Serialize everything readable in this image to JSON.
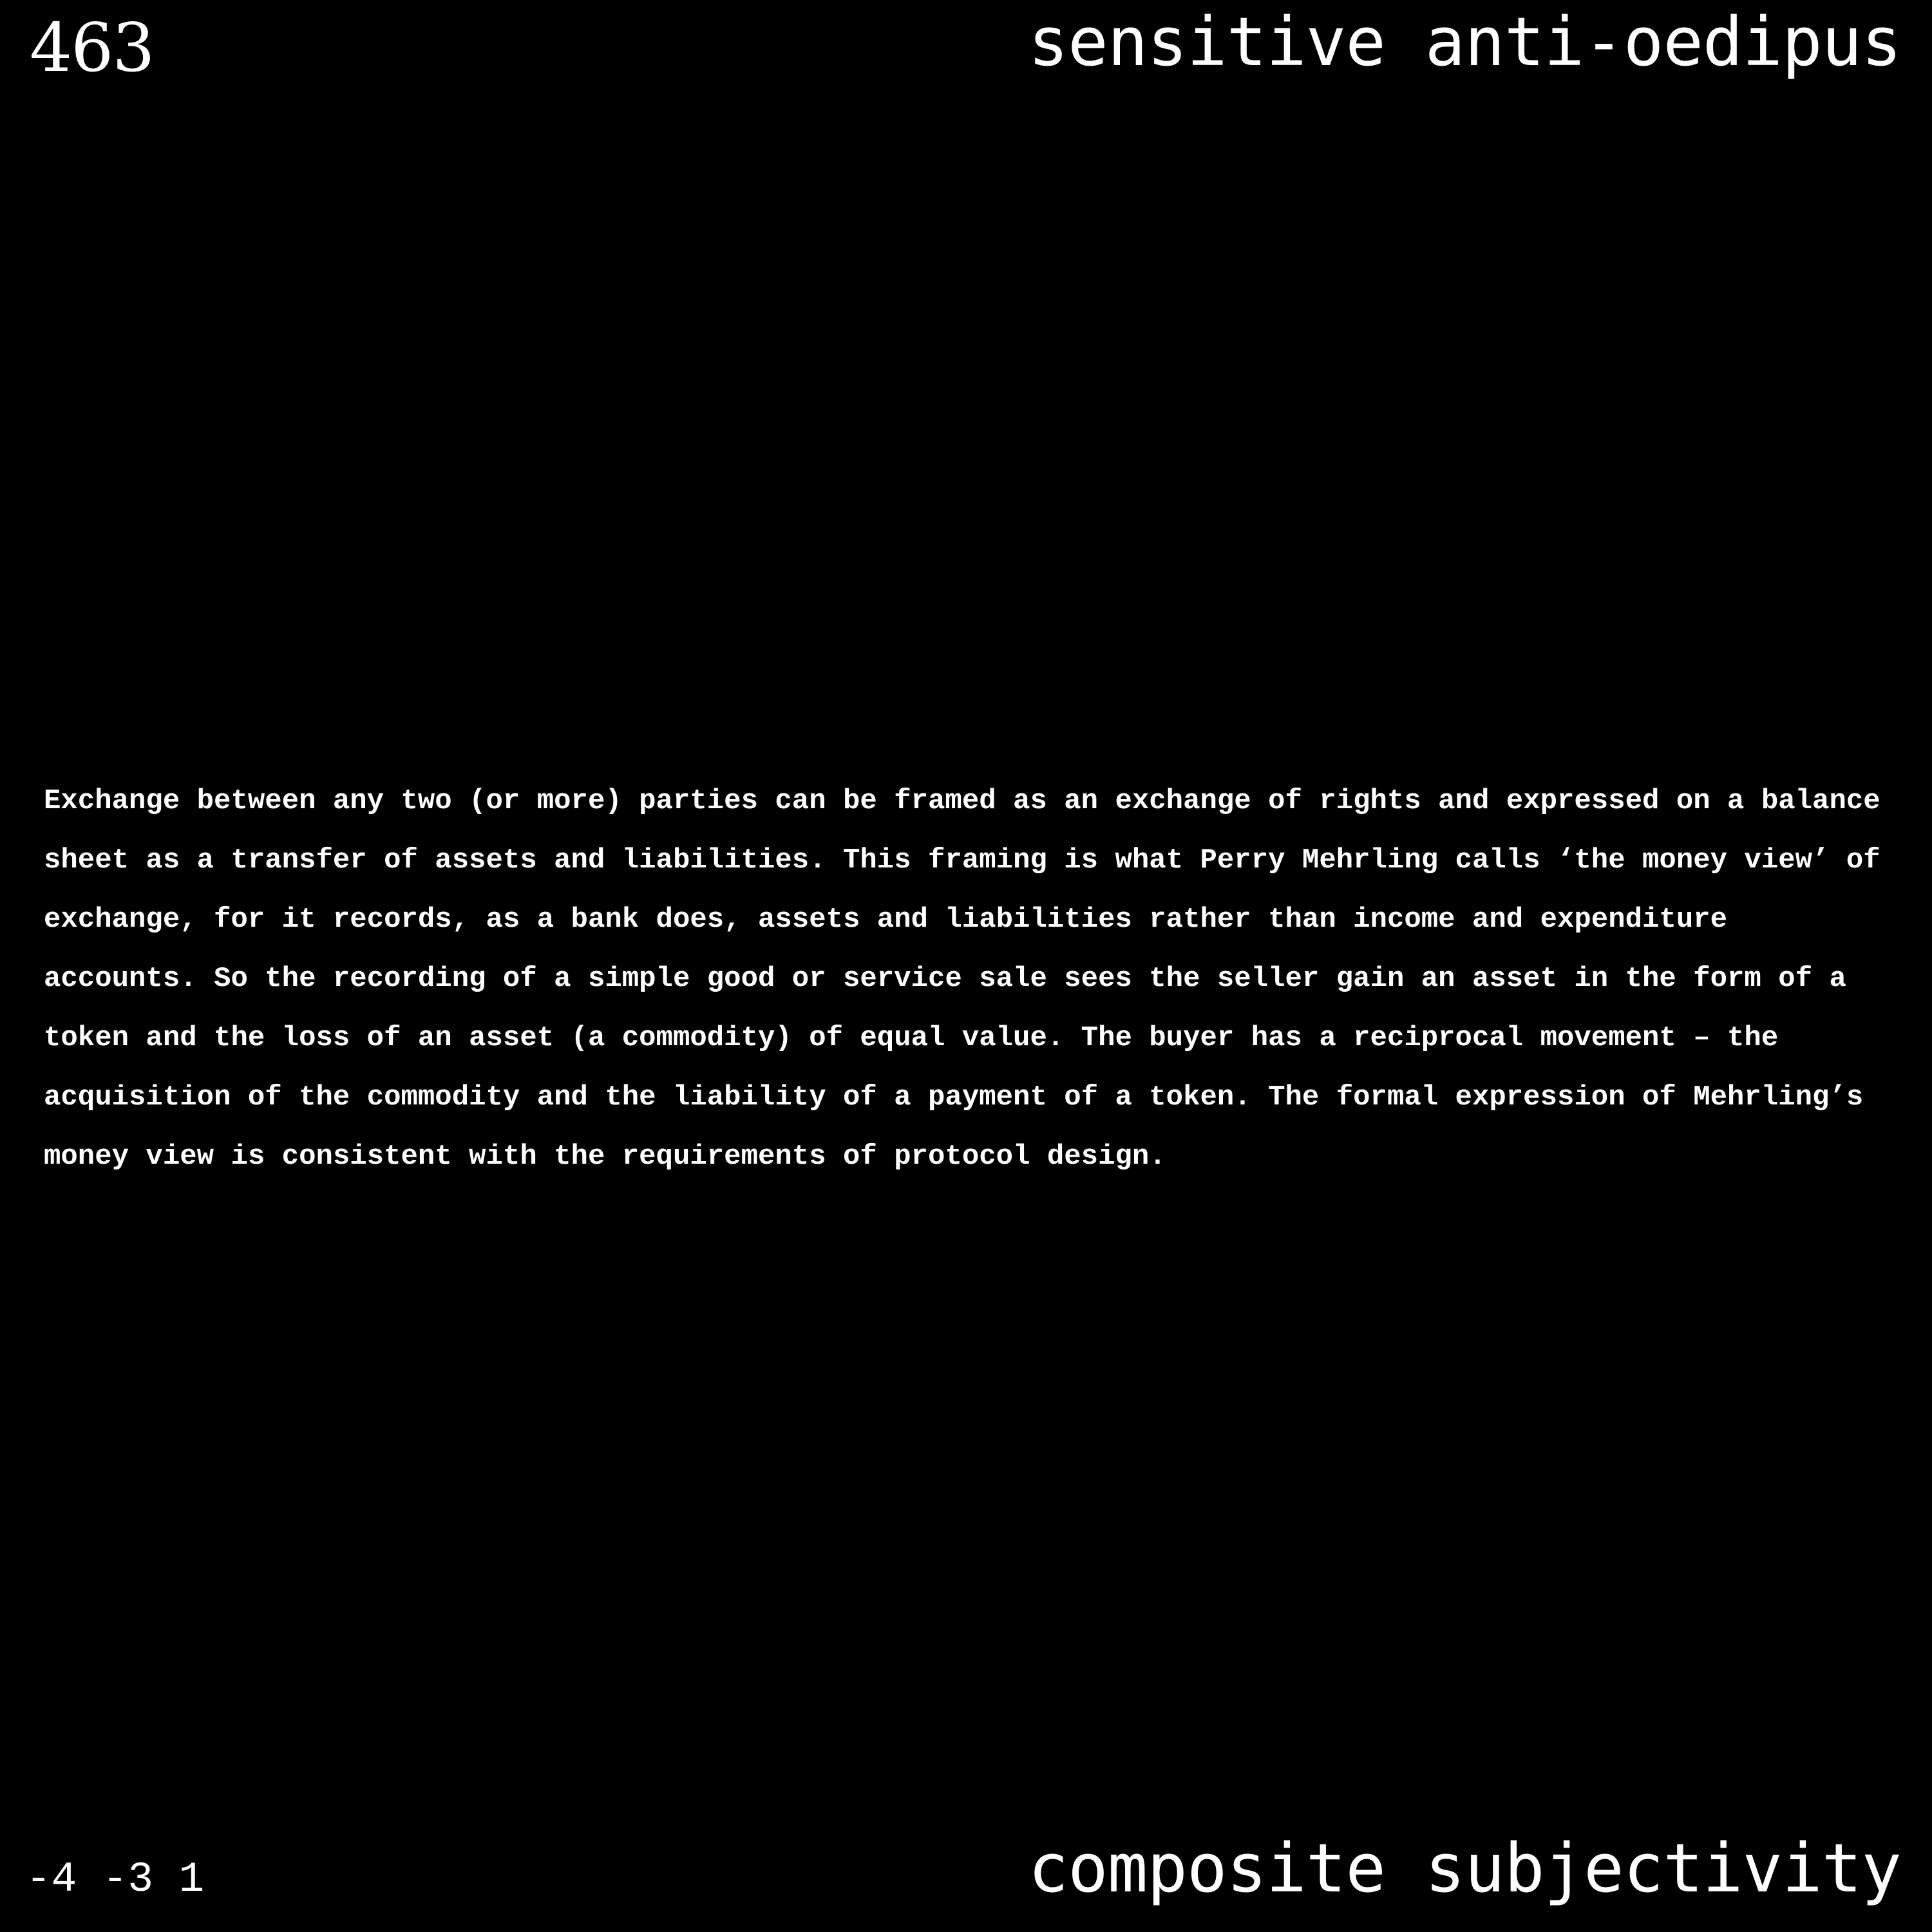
{
  "header": {
    "page_number": "463",
    "title": "sensitive anti-oedipus"
  },
  "body": {
    "lines": [
      "Exchange between any two (or more) parties can be framed as an exchange of rights and expressed on a balance",
      "sheet as a transfer of assets and liabilities. This framing is what Perry Mehrling calls ‘the money view’ of",
      "exchange, for it records, as a bank does, assets and liabilities rather than income and expenditure",
      "accounts. So the recording of a simple good or service sale sees the seller gain an asset in the form of a",
      "token and the loss of an asset (a commodity) of equal value. The buyer has a reciprocal movement – the",
      "acquisition of the commodity and the liability of a payment of a token. The formal expression of Mehrling’s",
      "money view is consistent with the requirements of protocol design."
    ]
  },
  "footer": {
    "coordinates": "-4 -3 1",
    "subtitle": "composite subjectivity"
  }
}
